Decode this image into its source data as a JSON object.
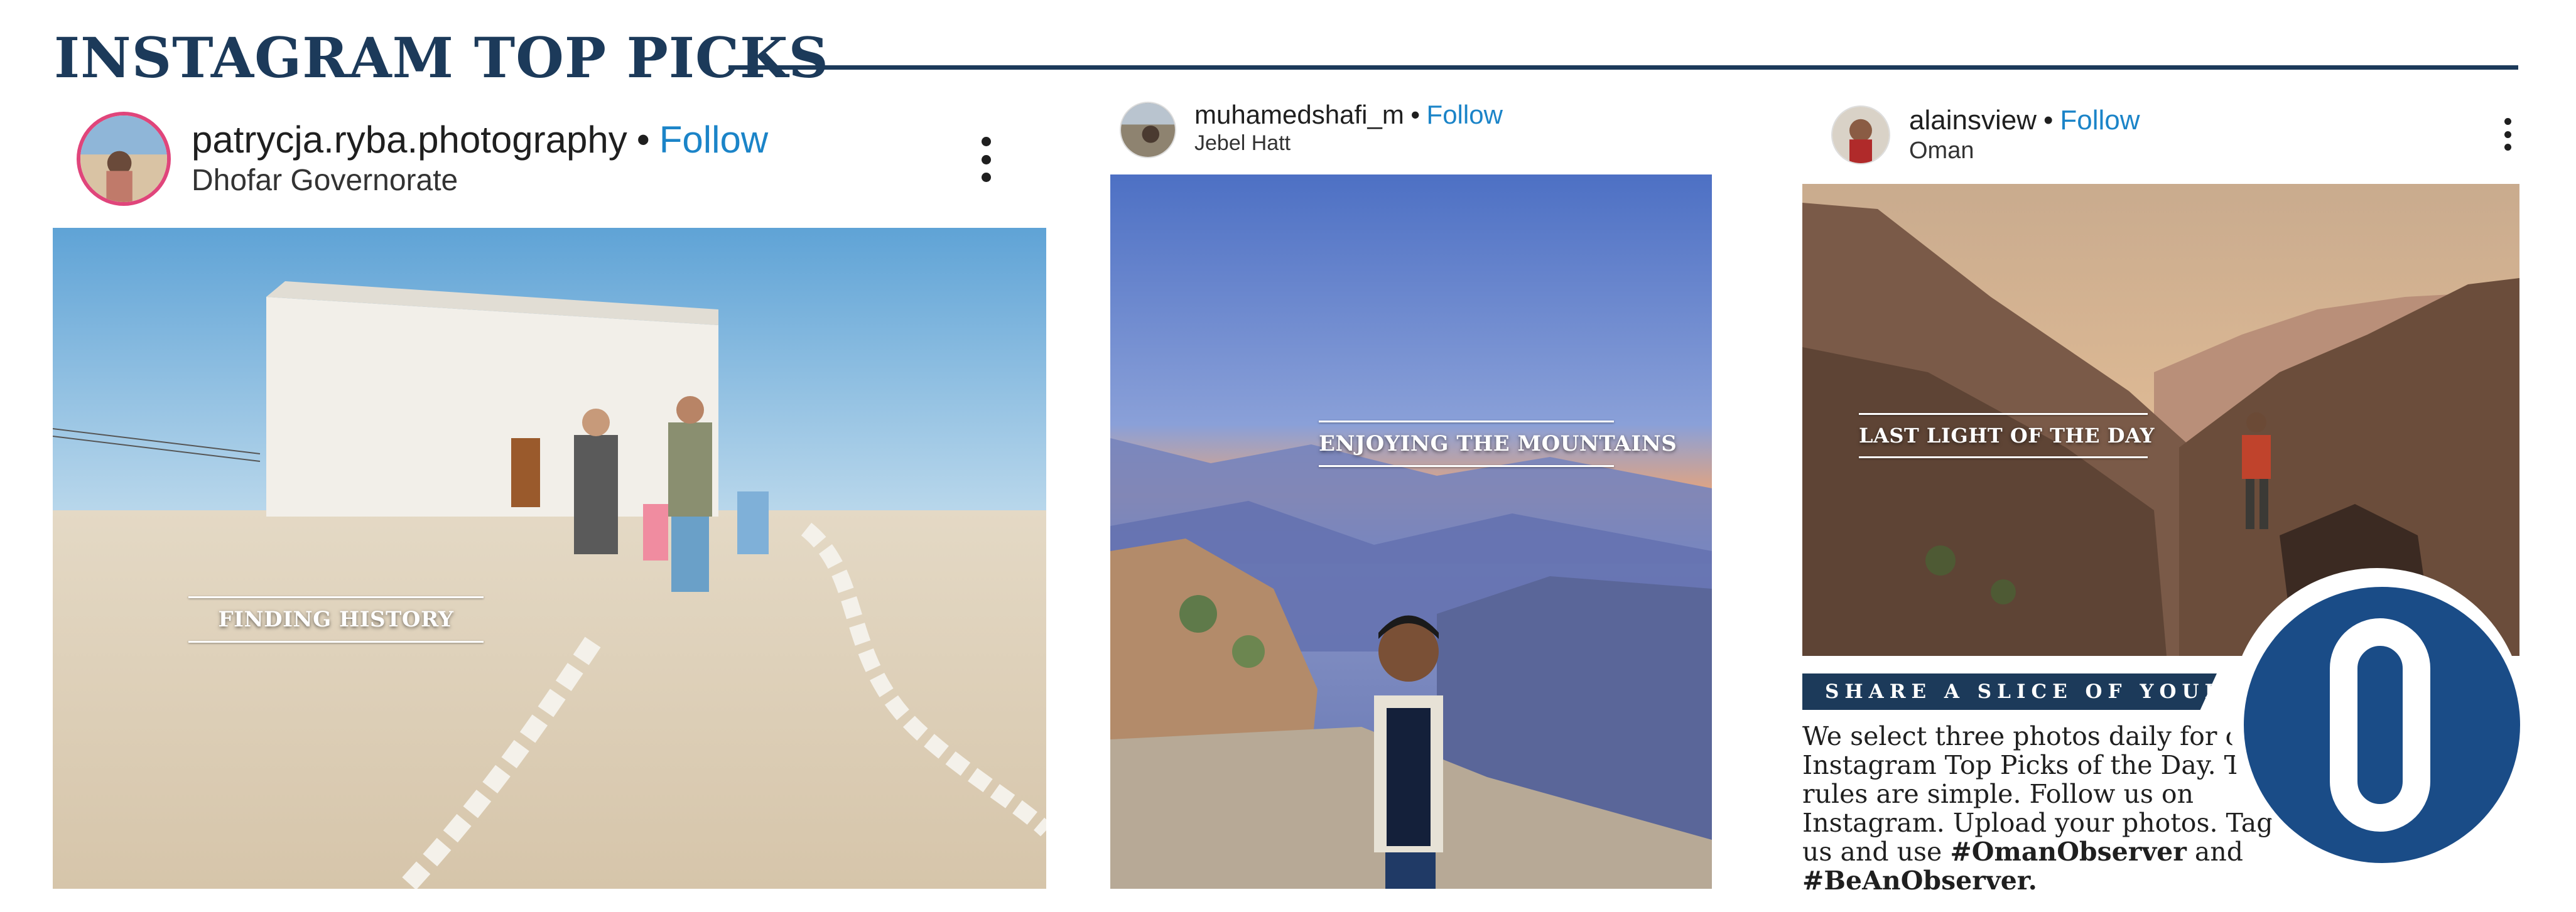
{
  "header": {
    "title": "INSTAGRAM TOP PICKS"
  },
  "posts": [
    {
      "username": "patrycja.ryba.photography",
      "separator": "•",
      "follow_label": "Follow",
      "location": "Dhofar Governorate",
      "caption": "FINDING HISTORY",
      "avatar_icon": "user-avatar-icon",
      "menu_icon": "more-vertical-icon"
    },
    {
      "username": "muhamedshafi_m",
      "separator": "•",
      "follow_label": "Follow",
      "location": "Jebel Hatt",
      "caption": "ENJOYING THE MOUNTAINS",
      "avatar_icon": "user-avatar-icon"
    },
    {
      "username": "alainsview",
      "separator": "•",
      "follow_label": "Follow",
      "location": "Oman",
      "caption": "LAST LIGHT OF THE DAY",
      "avatar_icon": "user-avatar-icon",
      "menu_icon": "more-vertical-icon"
    }
  ],
  "share": {
    "banner": "SHARE A SLICE OF YOUR LIFE",
    "body": "We select three photos daily for our Instagram Top Picks of the Day. The rules are simple. Follow us on Instagram. Upload your photos. Tag us and use",
    "hashtag1": "#OmanObserver",
    "and": "and",
    "hashtag2": "#BeAnObserver."
  },
  "colors": {
    "brand_navy": "#1c3a5a",
    "follow_blue": "#1b84c8",
    "logo_blue": "#1a4c87"
  }
}
